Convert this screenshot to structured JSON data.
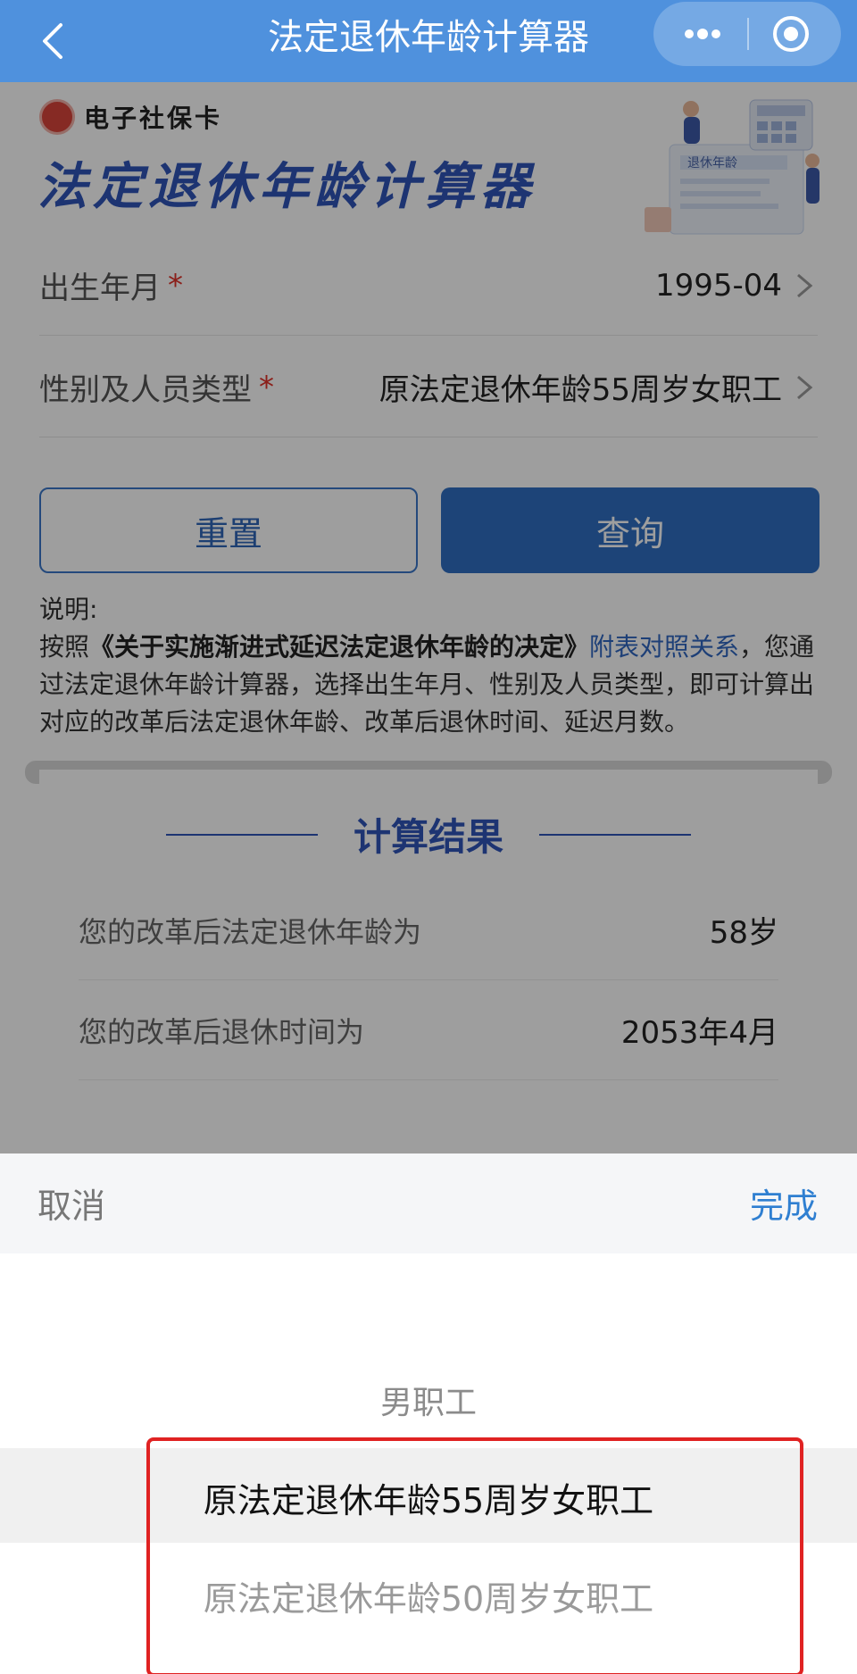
{
  "topbar": {
    "title": "法定退休年龄计算器",
    "back_icon": "chevron-left-icon",
    "more_icon": "more-dots-icon",
    "close_icon": "target-circle-icon"
  },
  "brand": {
    "name": "电子社保卡",
    "title": "法定退休年龄计算器",
    "illustration_text": "退休年龄"
  },
  "form": {
    "birth": {
      "label": "出生年月",
      "required": "*",
      "value": "1995-04"
    },
    "type": {
      "label": "性别及人员类型",
      "required": "*",
      "value": "原法定退休年龄55周岁女职工"
    }
  },
  "buttons": {
    "reset": "重置",
    "query": "查询"
  },
  "notes": {
    "heading": "说明:",
    "prefix": "按照",
    "decision": "《关于实施渐进式延迟法定退休年龄的决定》",
    "link": "附表对照关系",
    "rest": "，您通过法定退休年龄计算器，选择出生年月、性别及人员类型，即可计算出对应的改革后法定退休年龄、改革后退休时间、延迟月数。"
  },
  "result": {
    "title": "计算结果",
    "rows": [
      {
        "label": "您的改革后法定退休年龄为",
        "value": "58岁"
      },
      {
        "label": "您的改革后退休时间为",
        "value": "2053年4月"
      }
    ]
  },
  "picker": {
    "cancel": "取消",
    "done": "完成",
    "options": [
      "男职工",
      "原法定退休年龄55周岁女职工",
      "原法定退休年龄50周岁女职工"
    ],
    "selected": "原法定退休年龄55周岁女职工"
  },
  "colors": {
    "topbar": "#4f91dd",
    "brand_blue": "#2f55b8",
    "primary_button": "#2f6fc2",
    "link": "#2f66c0",
    "required": "#e0332a",
    "highlight_box": "#e02222",
    "done_text": "#2f7fd1"
  }
}
